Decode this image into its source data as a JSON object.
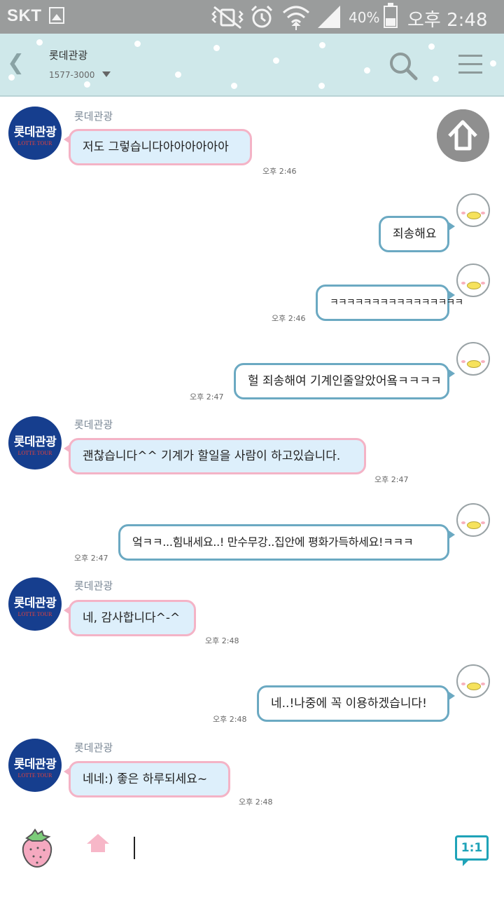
{
  "status_bar": {
    "carrier": "SKT",
    "battery_percent": "40%",
    "battery_level": 0.4,
    "time": "오후 2:48"
  },
  "header": {
    "title": "롯데관광",
    "phone": "1577-3000"
  },
  "avatar": {
    "logo_ko": "롯데관광",
    "logo_en": "LOTTE TOUR"
  },
  "messages": [
    {
      "dir": "in",
      "sender": "롯데관광",
      "text": "저도 그렇습니다아아아아아아",
      "time": "오후 2:46"
    },
    {
      "dir": "out",
      "text": "죄송해요",
      "time": ""
    },
    {
      "dir": "out",
      "text": "ㅋㅋㅋㅋㅋㅋㅋㅋㅋㅋㅋㅋㅋㅋㅋㅋ",
      "time": "오후 2:46"
    },
    {
      "dir": "out",
      "text": "헐 죄송해여 기계인줄알았어욬ㅋㅋㅋㅋ",
      "time": "오후 2:47"
    },
    {
      "dir": "in",
      "sender": "롯데관광",
      "text": "괜찮습니다^^ 기계가 할일을 사람이 하고있습니다.",
      "time": "오후 2:47"
    },
    {
      "dir": "out",
      "text": "엌ㅋㅋ...힘내세요..! 만수무강..집안에 평화가득하세요!ㅋㅋㅋ",
      "time": "오후 2:47"
    },
    {
      "dir": "in",
      "sender": "롯데관광",
      "text": "네, 감사합니다^-^",
      "time": "오후 2:48"
    },
    {
      "dir": "out",
      "text": "네..!나중에 꼭 이용하겠습니다!",
      "time": "오후 2:48"
    },
    {
      "dir": "in",
      "sender": "롯데관광",
      "text": "네네:) 좋은 하루되세요~",
      "time": "오후 2:48"
    }
  ],
  "input_bar": {
    "one_to_one_label": "1:1"
  },
  "colors": {
    "header_bg": "#cfe8ea",
    "incoming_bubble_bg": "#ddeffb",
    "incoming_bubble_border": "#f4b3c6",
    "outgoing_bubble_border": "#6ba9c2",
    "avatar_bg": "#163e8e",
    "accent": "#1fa3b8"
  },
  "icons": {
    "back": "chevron-left-icon",
    "search": "search-icon",
    "menu": "menu-icon",
    "scroll_top": "arrow-up-icon",
    "emoticon": "strawberry-icon",
    "home": "home-icon"
  }
}
